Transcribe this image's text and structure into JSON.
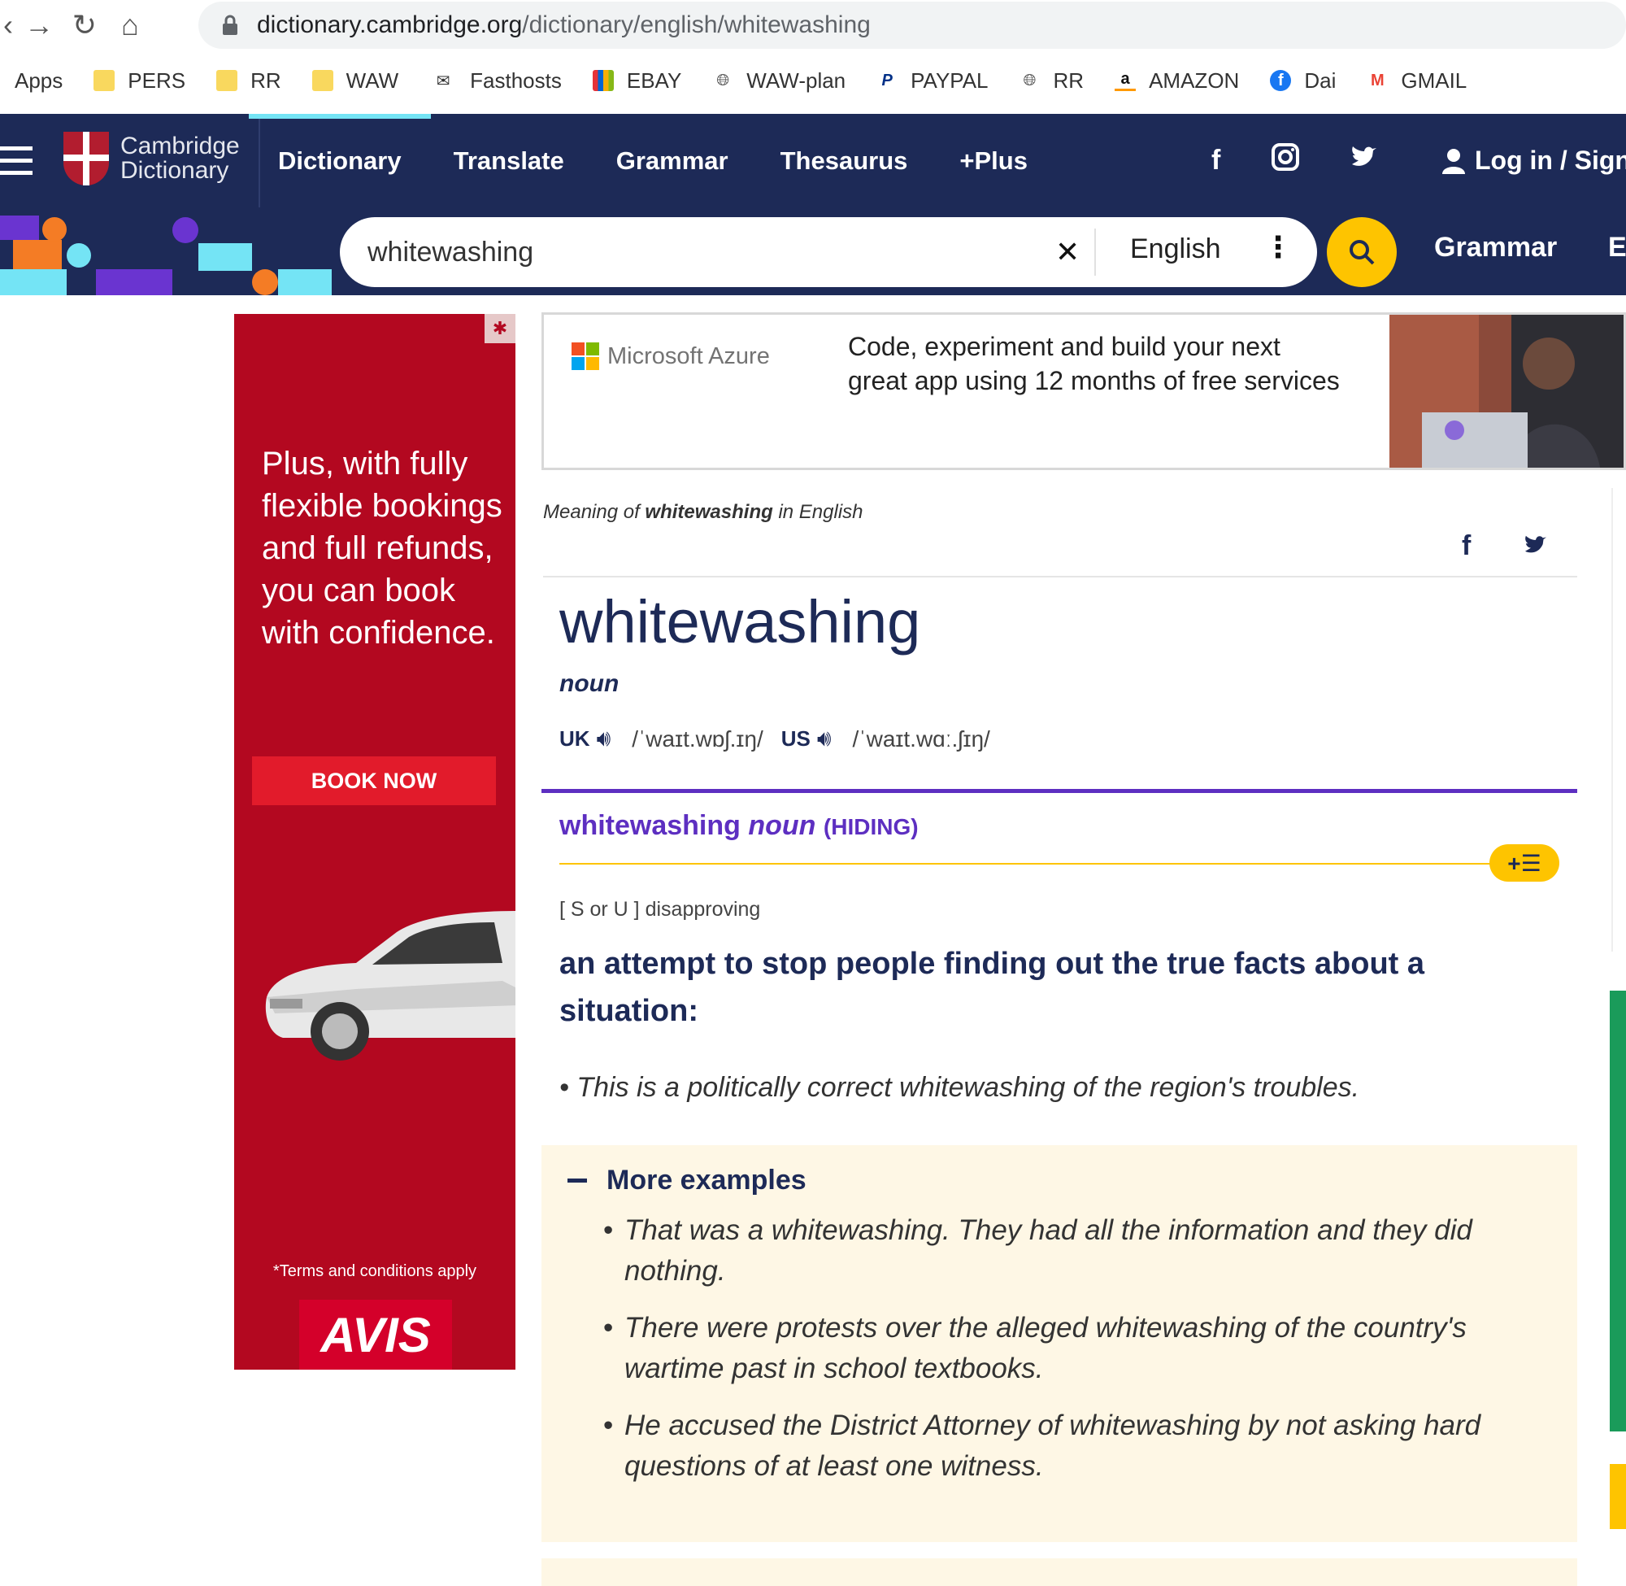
{
  "browser": {
    "url_host": "dictionary.cambridge.org",
    "url_path": "/dictionary/english/whitewashing",
    "bookmarks": [
      {
        "label": "Apps",
        "icon": "apps-grid-icon"
      },
      {
        "label": "PERS",
        "icon": "folder-icon"
      },
      {
        "label": "RR",
        "icon": "folder-icon"
      },
      {
        "label": "WAW",
        "icon": "folder-icon"
      },
      {
        "label": "Fasthosts",
        "icon": "envelope-icon"
      },
      {
        "label": "EBAY",
        "icon": "shopping-bag-icon"
      },
      {
        "label": "WAW-plan",
        "icon": "globe-icon"
      },
      {
        "label": "PAYPAL",
        "icon": "paypal-icon"
      },
      {
        "label": "RR",
        "icon": "globe-icon"
      },
      {
        "label": "AMAZON",
        "icon": "amazon-icon"
      },
      {
        "label": "Dai",
        "icon": "facebook-icon"
      },
      {
        "label": "GMAIL",
        "icon": "gmail-icon"
      }
    ]
  },
  "header": {
    "logo_line1": "Cambridge",
    "logo_line2": "Dictionary",
    "tabs": [
      {
        "label": "Dictionary",
        "active": true
      },
      {
        "label": "Translate",
        "active": false
      },
      {
        "label": "Grammar",
        "active": false
      },
      {
        "label": "Thesaurus",
        "active": false
      },
      {
        "label": "+Plus",
        "active": false
      }
    ],
    "login_label": "Log in / Sign up"
  },
  "search": {
    "value": "whitewashing",
    "language": "English",
    "right_link_1": "Grammar",
    "right_link_2": "English"
  },
  "ad_left": {
    "headline": "Plus, with fully flexible bookings and full refunds, you can book with confidence.",
    "button": "BOOK NOW",
    "terms": "*Terms and conditions apply",
    "brand": "AVIS"
  },
  "ad_top": {
    "brand": "Microsoft Azure",
    "copy_line1": "Code, experiment and build your next",
    "copy_line2": "great app using 12 months of free services"
  },
  "entry": {
    "meaning_prefix": "Meaning of",
    "meaning_word": "whitewashing",
    "meaning_suffix": "in English",
    "headword": "whitewashing",
    "pos": "noun",
    "uk_label": "UK",
    "uk_ipa": "/ˈwaɪt.wɒʃ.ɪŋ/",
    "us_label": "US",
    "us_ipa": "/ˈwaɪt.wɑː.ʃɪŋ/",
    "sense_word": "whitewashing",
    "sense_pos": "noun",
    "sense_guide": "(HIDING)",
    "grammar": "[ S or U ] disapproving",
    "definition": "an attempt to stop people finding out the true facts about a situation:",
    "example": "This is a politically correct whitewashing of the region's troubles.",
    "more_title": "More examples",
    "more_examples": [
      "That was a whitewashing. They had all the information and they did nothing.",
      "There were protests over the alleged whitewashing of the country's wartime past in school textbooks.",
      "He accused the District Attorney of whitewashing by not asking hard questions of at least one witness."
    ]
  },
  "colors": {
    "brand_navy": "#1d2a57",
    "accent_purple": "#5d2fc1",
    "accent_yellow": "#fec400",
    "ad_red": "#b30820"
  }
}
